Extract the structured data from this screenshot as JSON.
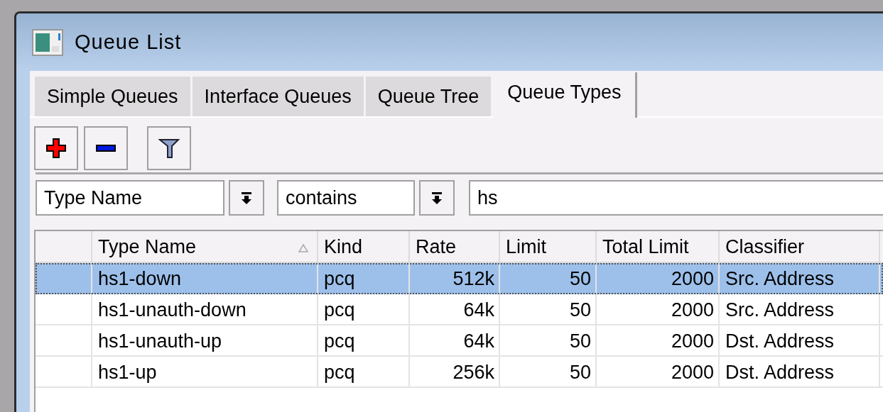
{
  "window": {
    "title": "Queue List"
  },
  "tabs": [
    {
      "label": "Simple Queues",
      "selected": false
    },
    {
      "label": "Interface Queues",
      "selected": false
    },
    {
      "label": "Queue Tree",
      "selected": false
    },
    {
      "label": "Queue Types",
      "selected": true
    }
  ],
  "toolbar": [
    {
      "kind": "add"
    },
    {
      "kind": "remove"
    },
    {
      "kind": "filter"
    }
  ],
  "filter": {
    "field": "Type Name",
    "operator": "contains",
    "value": "hs"
  },
  "table": {
    "columns": [
      {
        "label": "Type Name",
        "sorted": true
      },
      {
        "label": "Kind",
        "sorted": false
      },
      {
        "label": "Rate",
        "sorted": false
      },
      {
        "label": "Limit",
        "sorted": false
      },
      {
        "label": "Total Limit",
        "sorted": false
      },
      {
        "label": "Classifier",
        "sorted": false
      }
    ],
    "rows": [
      {
        "selected": true,
        "cells": [
          "hs1-down",
          "pcq",
          "512k",
          "50",
          "2000",
          "Src. Address"
        ]
      },
      {
        "selected": false,
        "cells": [
          "hs1-unauth-down",
          "pcq",
          "64k",
          "50",
          "2000",
          "Src. Address"
        ]
      },
      {
        "selected": false,
        "cells": [
          "hs1-unauth-up",
          "pcq",
          "64k",
          "50",
          "2000",
          "Dst. Address"
        ]
      },
      {
        "selected": false,
        "cells": [
          "hs1-up",
          "pcq",
          "256k",
          "50",
          "2000",
          "Dst. Address"
        ]
      }
    ]
  }
}
